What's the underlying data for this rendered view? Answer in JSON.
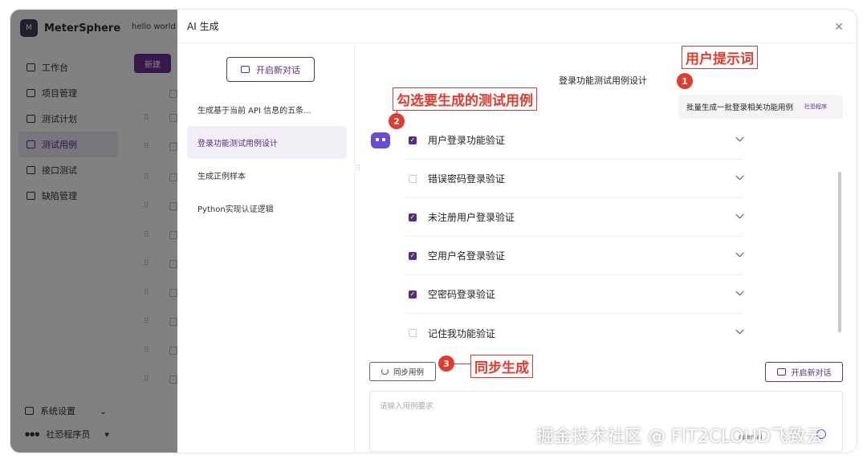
{
  "app": {
    "brand": "MeterSphere",
    "workspace": "hello world",
    "new_button": "新建",
    "nav": [
      "工作台",
      "项目管理",
      "测试计划",
      "测试用例",
      "接口测试",
      "缺陷管理"
    ],
    "active_nav": "测试用例",
    "settings": "系统设置",
    "user": "社恐程序员"
  },
  "drawer": {
    "title": "AI 生成",
    "new_conversation": "开启新对话",
    "conversations": [
      "生成基于当前 API 信息的五条...",
      "登录功能测试用例设计",
      "生成正例样本",
      "Python实现认证逻辑"
    ],
    "chat_title": "登录功能测试用例设计",
    "user_prompt": "批量生成一批登录相关功能用例",
    "prompt_sender": "社恐程序",
    "cases": [
      {
        "label": "用户登录功能验证",
        "checked": true
      },
      {
        "label": "错误密码登录验证",
        "checked": false
      },
      {
        "label": "未注册用户登录验证",
        "checked": true
      },
      {
        "label": "空用户名登录验证",
        "checked": true
      },
      {
        "label": "空密码登录验证",
        "checked": true
      },
      {
        "label": "记住我功能验证",
        "checked": false
      }
    ],
    "sync_button": "同步用例",
    "new_conversation_bottom": "开启新对话",
    "input_placeholder": "请输入用例要求",
    "model": "open.ai"
  },
  "annotations": {
    "callout_1": "用户提示词",
    "callout_2": "勾选要生成的测试用例",
    "callout_3": "同步生成",
    "badge_1": "1",
    "badge_2": "2",
    "badge_3": "3"
  },
  "watermark": "掘金技术社区 @ FIT2CLOUD飞致云",
  "colors": {
    "accent": "#5a2d82",
    "annotation": "#e23b2e",
    "bot": "#6a4bd8"
  }
}
